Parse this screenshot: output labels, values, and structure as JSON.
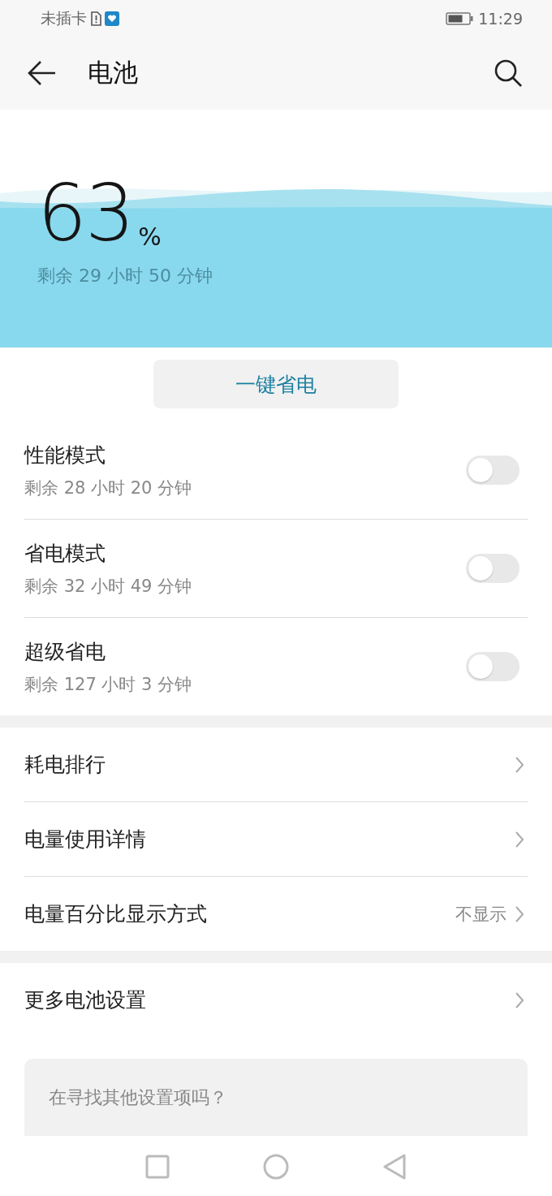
{
  "status_bar": {
    "carrier": "未插卡",
    "time": "11:29"
  },
  "header": {
    "title": "电池"
  },
  "battery": {
    "percent": "63",
    "unit": "%",
    "remaining": "剩余 29 小时 50 分钟"
  },
  "optimize_button": "一键省电",
  "modes": [
    {
      "title": "性能模式",
      "subtitle": "剩余 28 小时 20 分钟",
      "on": false
    },
    {
      "title": "省电模式",
      "subtitle": "剩余 32 小时 49 分钟",
      "on": false
    },
    {
      "title": "超级省电",
      "subtitle": "剩余 127 小时 3 分钟",
      "on": false
    }
  ],
  "menu_groups": [
    [
      {
        "label": "耗电排行"
      },
      {
        "label": "电量使用详情"
      },
      {
        "label": "电量百分比显示方式",
        "value": "不显示"
      }
    ],
    [
      {
        "label": "更多电池设置"
      }
    ]
  ],
  "search_prompt": "在寻找其他设置项吗？"
}
